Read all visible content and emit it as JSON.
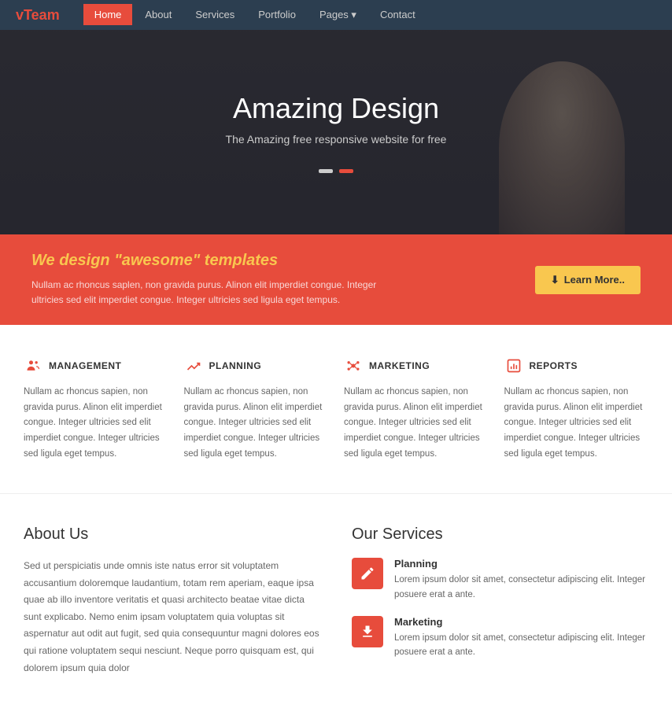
{
  "navbar": {
    "brand_v": "v",
    "brand_name": "Team",
    "links": [
      {
        "label": "Home",
        "active": true
      },
      {
        "label": "About",
        "active": false
      },
      {
        "label": "Services",
        "active": false
      },
      {
        "label": "Portfolio",
        "active": false
      },
      {
        "label": "Pages ▾",
        "active": false
      },
      {
        "label": "Contact",
        "active": false
      }
    ]
  },
  "hero": {
    "title": "Amazing Design",
    "subtitle": "The Amazing free responsive website for free"
  },
  "cta": {
    "heading_pre": "We design ",
    "heading_highlight": "\"awesome\"",
    "heading_post": " templates",
    "body": "Nullam ac rhoncus saplen, non gravida purus. Alinon elit imperdiet congue. Integer ultricies sed elit imperdiet congue. Integer ultricies sed ligula eget tempus.",
    "btn_label": "Learn More.."
  },
  "features": [
    {
      "icon": "management",
      "title": "MANAGEMENT",
      "text": "Nullam ac rhoncus sapien, non gravida purus. Alinon elit imperdiet congue. Integer ultricies sed elit imperdiet congue. Integer ultricies sed ligula eget tempus."
    },
    {
      "icon": "planning",
      "title": "PLANNING",
      "text": "Nullam ac rhoncus sapien, non gravida purus. Alinon elit imperdiet congue. Integer ultricies sed elit imperdiet congue. Integer ultricies sed ligula eget tempus."
    },
    {
      "icon": "marketing",
      "title": "MARKETING",
      "text": "Nullam ac rhoncus sapien, non gravida purus. Alinon elit imperdiet congue. Integer ultricies sed elit imperdiet congue. Integer ultricies sed ligula eget tempus."
    },
    {
      "icon": "reports",
      "title": "REPORTS",
      "text": "Nullam ac rhoncus sapien, non gravida purus. Alinon elit imperdiet congue. Integer ultricies sed elit imperdiet congue. Integer ultricies sed ligula eget tempus."
    }
  ],
  "about": {
    "title": "About Us",
    "text": "Sed ut perspiciatis unde omnis iste natus error sit voluptatem accusantium doloremque laudantium, totam rem aperiam, eaque ipsa quae ab illo inventore veritatis et quasi architecto beatae vitae dicta sunt explicabo. Nemo enim ipsam voluptatem quia voluptas sit aspernatur aut odit aut fugit, sed quia consequuntur magni dolores eos qui ratione voluptatem sequi nesciunt. Neque porro quisquam est, qui dolorem ipsum quia dolor"
  },
  "services": {
    "title": "Our Services",
    "items": [
      {
        "icon": "pencil",
        "name": "Planning",
        "desc": "Lorem ipsum dolor sit amet, consectetur adipiscing elit. Integer posuere erat a ante."
      },
      {
        "icon": "download",
        "name": "Marketing",
        "desc": "Lorem ipsum dolor sit amet, consectetur adipiscing elit. Integer posuere erat a ante."
      }
    ]
  }
}
